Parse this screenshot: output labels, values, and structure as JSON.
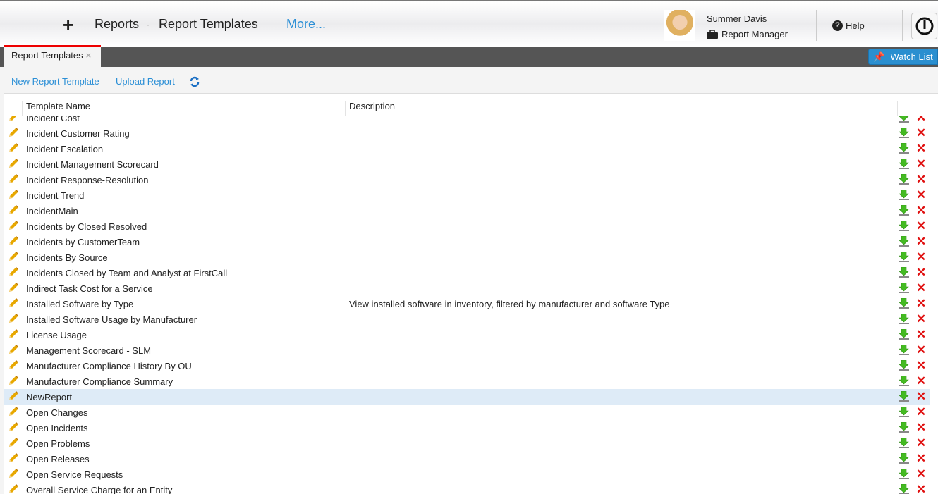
{
  "header": {
    "breadcrumb": [
      "Reports",
      "Report Templates"
    ],
    "more": "More...",
    "user_name": "Summer Davis",
    "user_role": "Report Manager",
    "help": "Help"
  },
  "tabs": [
    {
      "label": "Report Templates",
      "close": "×"
    }
  ],
  "watch_list": "Watch List",
  "toolbar": {
    "new": "New Report Template",
    "upload": "Upload Report"
  },
  "grid": {
    "columns": [
      "Template Name",
      "Description"
    ],
    "rows": [
      {
        "name": "Incident Cost",
        "desc": ""
      },
      {
        "name": "Incident Customer Rating",
        "desc": ""
      },
      {
        "name": "Incident Escalation",
        "desc": ""
      },
      {
        "name": "Incident Management Scorecard",
        "desc": ""
      },
      {
        "name": "Incident Response-Resolution",
        "desc": ""
      },
      {
        "name": "Incident Trend",
        "desc": ""
      },
      {
        "name": "IncidentMain",
        "desc": ""
      },
      {
        "name": "Incidents by Closed Resolved",
        "desc": ""
      },
      {
        "name": "Incidents by CustomerTeam",
        "desc": ""
      },
      {
        "name": "Incidents By Source",
        "desc": ""
      },
      {
        "name": "Incidents Closed by Team and Analyst at FirstCall",
        "desc": ""
      },
      {
        "name": "Indirect Task Cost for a Service",
        "desc": ""
      },
      {
        "name": "Installed Software by Type",
        "desc": "View installed software in inventory, filtered by manufacturer and software Type"
      },
      {
        "name": "Installed Software Usage by Manufacturer",
        "desc": ""
      },
      {
        "name": "License Usage",
        "desc": ""
      },
      {
        "name": "Management Scorecard - SLM",
        "desc": ""
      },
      {
        "name": "Manufacturer Compliance History By OU",
        "desc": ""
      },
      {
        "name": "Manufacturer Compliance Summary",
        "desc": ""
      },
      {
        "name": "NewReport",
        "desc": "",
        "selected": true
      },
      {
        "name": "Open Changes",
        "desc": ""
      },
      {
        "name": "Open Incidents",
        "desc": ""
      },
      {
        "name": "Open Problems",
        "desc": ""
      },
      {
        "name": "Open Releases",
        "desc": ""
      },
      {
        "name": "Open Service Requests",
        "desc": ""
      },
      {
        "name": "Overall Service Charge for an Entity",
        "desc": ""
      }
    ]
  },
  "colors": {
    "accent": "#2b8fd6",
    "tab_active": "#ee0000",
    "delete": "#e01010",
    "download": "#44bb22"
  }
}
